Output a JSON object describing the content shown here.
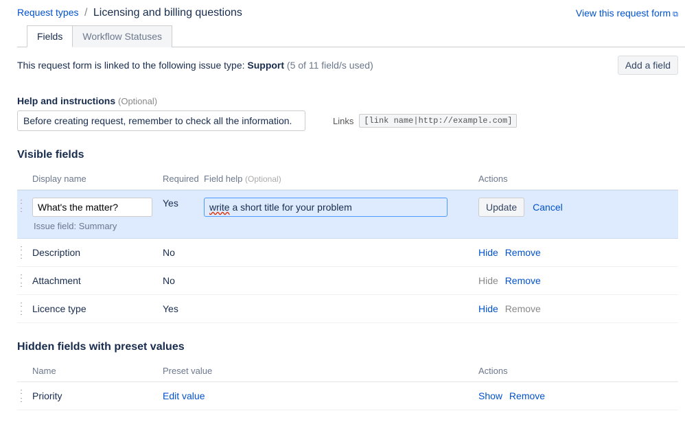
{
  "breadcrumb": {
    "parent": "Request types",
    "current": "Licensing and billing questions"
  },
  "viewLink": "View this request form",
  "tabs": {
    "fields": "Fields",
    "workflow": "Workflow Statuses"
  },
  "info": {
    "text_a": "This request form is linked to the following issue type: ",
    "text_b": "Support",
    "text_c": " (5 of 11 field/s used)"
  },
  "addField": "Add a field",
  "help": {
    "title": "Help and instructions",
    "optional": "(Optional)",
    "value": "Before creating request, remember to check all the information.",
    "linksLabel": "Links",
    "linksCode": "[link name|http://example.com]"
  },
  "visible": {
    "title": "Visible fields",
    "headers": {
      "name": "Display name",
      "required": "Required",
      "help": "Field help",
      "helpOpt": "(Optional)",
      "actions": "Actions"
    },
    "editing": {
      "name": "What's the matter?",
      "required": "Yes",
      "help_prefix": "write",
      "help_rest": " a short title for your problem",
      "issueField": "Issue field: Summary",
      "update": "Update",
      "cancel": "Cancel"
    },
    "rows": [
      {
        "name": "Description",
        "required": "No",
        "hide": "Hide",
        "remove": "Remove",
        "hideLink": true,
        "removeLink": true
      },
      {
        "name": "Attachment",
        "required": "No",
        "hide": "Hide",
        "remove": "Remove",
        "hideLink": false,
        "removeLink": true
      },
      {
        "name": "Licence type",
        "required": "Yes",
        "hide": "Hide",
        "remove": "Remove",
        "hideLink": true,
        "removeLink": false
      }
    ]
  },
  "hidden": {
    "title": "Hidden fields with preset values",
    "headers": {
      "name": "Name",
      "preset": "Preset value",
      "actions": "Actions"
    },
    "row": {
      "name": "Priority",
      "preset": "Edit value",
      "show": "Show",
      "remove": "Remove"
    }
  }
}
